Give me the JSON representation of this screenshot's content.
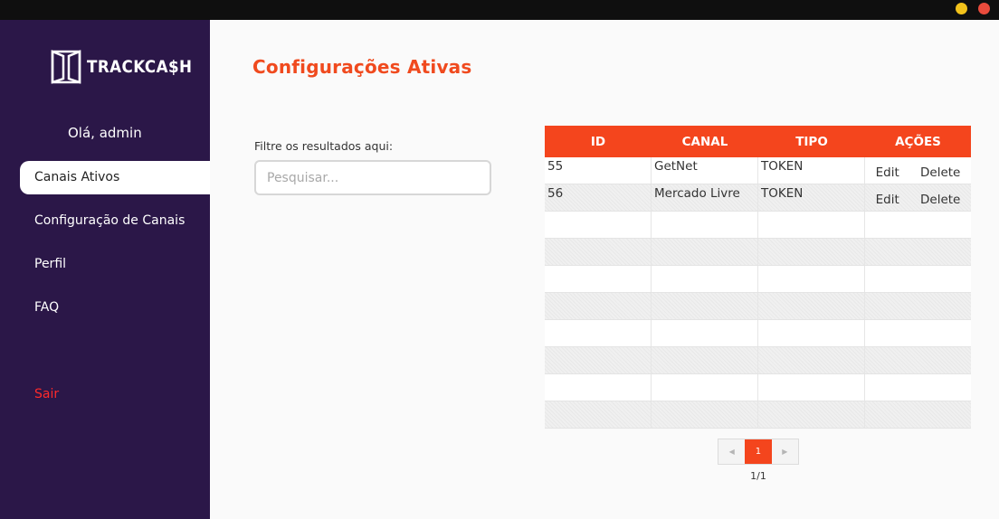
{
  "window": {
    "controls": [
      "minimize-button",
      "close-button"
    ]
  },
  "sidebar": {
    "logo_text": "TRACKCA$H",
    "greeting": "Olá, admin",
    "items": [
      {
        "label": "Canais Ativos",
        "active": true
      },
      {
        "label": "Configuração de Canais",
        "active": false
      },
      {
        "label": "Perfil",
        "active": false
      },
      {
        "label": "FAQ",
        "active": false
      }
    ],
    "logout_label": "Sair"
  },
  "main": {
    "title": "Configurações Ativas",
    "filter_label": "Filtre os resultados aqui:",
    "search_placeholder": "Pesquisar..."
  },
  "table": {
    "headers": [
      "ID",
      "CANAL",
      "TIPO",
      "AÇÕES"
    ],
    "rows": [
      {
        "id": "55",
        "canal": "GetNet",
        "tipo": "TOKEN",
        "edit": "Edit",
        "delete": "Delete"
      },
      {
        "id": "56",
        "canal": "Mercado Livre",
        "tipo": "TOKEN",
        "edit": "Edit",
        "delete": "Delete"
      }
    ]
  },
  "pagination": {
    "prev_icon": "◀",
    "next_icon": "▶",
    "current": "1",
    "info": "1/1"
  },
  "colors": {
    "sidebar_bg": "#2b1748",
    "accent": "#f4451d",
    "title": "#f04a1e",
    "logout": "#ff2a2a"
  }
}
